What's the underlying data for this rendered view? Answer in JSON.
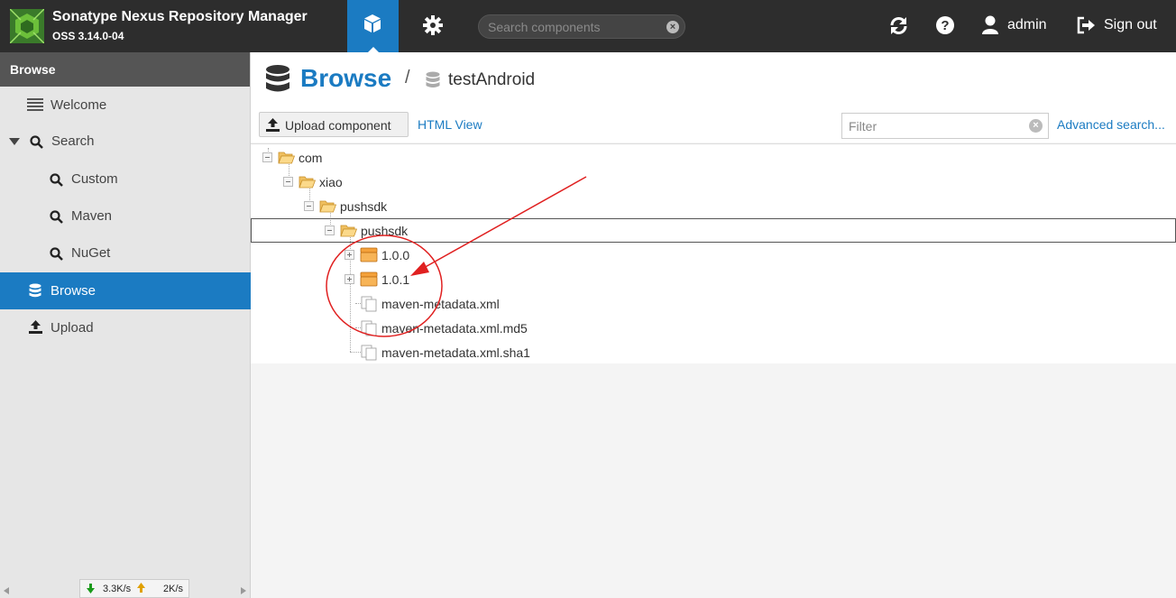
{
  "app": {
    "title": "Sonatype Nexus Repository Manager",
    "version": "OSS 3.14.0-04",
    "search_placeholder": "Search components",
    "user": "admin",
    "signout_label": "Sign out"
  },
  "sidebar": {
    "header": "Browse",
    "items": [
      {
        "label": "Welcome",
        "icon": "list-icon"
      },
      {
        "label": "Search",
        "icon": "search-icon"
      },
      {
        "label": "Custom",
        "icon": "search-icon"
      },
      {
        "label": "Maven",
        "icon": "search-icon"
      },
      {
        "label": "NuGet",
        "icon": "search-icon"
      },
      {
        "label": "Browse",
        "icon": "database-icon",
        "active": true
      },
      {
        "label": "Upload",
        "icon": "upload-icon"
      }
    ]
  },
  "status": {
    "down": "3.3K/s",
    "up": "2K/s"
  },
  "main": {
    "title": "Browse",
    "separator": "/",
    "repo": "testAndroid",
    "upload_label": "Upload component",
    "html_view_label": "HTML View",
    "filter_placeholder": "Filter",
    "advanced_label": "Advanced search..."
  },
  "tree": [
    {
      "label": "com",
      "type": "folder"
    },
    {
      "label": "xiao",
      "type": "folder"
    },
    {
      "label": "pushsdk",
      "type": "folder"
    },
    {
      "label": "pushsdk",
      "type": "folder",
      "selected": true
    },
    {
      "label": "1.0.0",
      "type": "component"
    },
    {
      "label": "1.0.1",
      "type": "component"
    },
    {
      "label": "maven-metadata.xml",
      "type": "asset"
    },
    {
      "label": "maven-metadata.xml.md5",
      "type": "asset"
    },
    {
      "label": "maven-metadata.xml.sha1",
      "type": "asset"
    }
  ],
  "colors": {
    "accent": "#1b7bc2",
    "topbar": "#2d2d2d",
    "annotation": "#e02020"
  }
}
